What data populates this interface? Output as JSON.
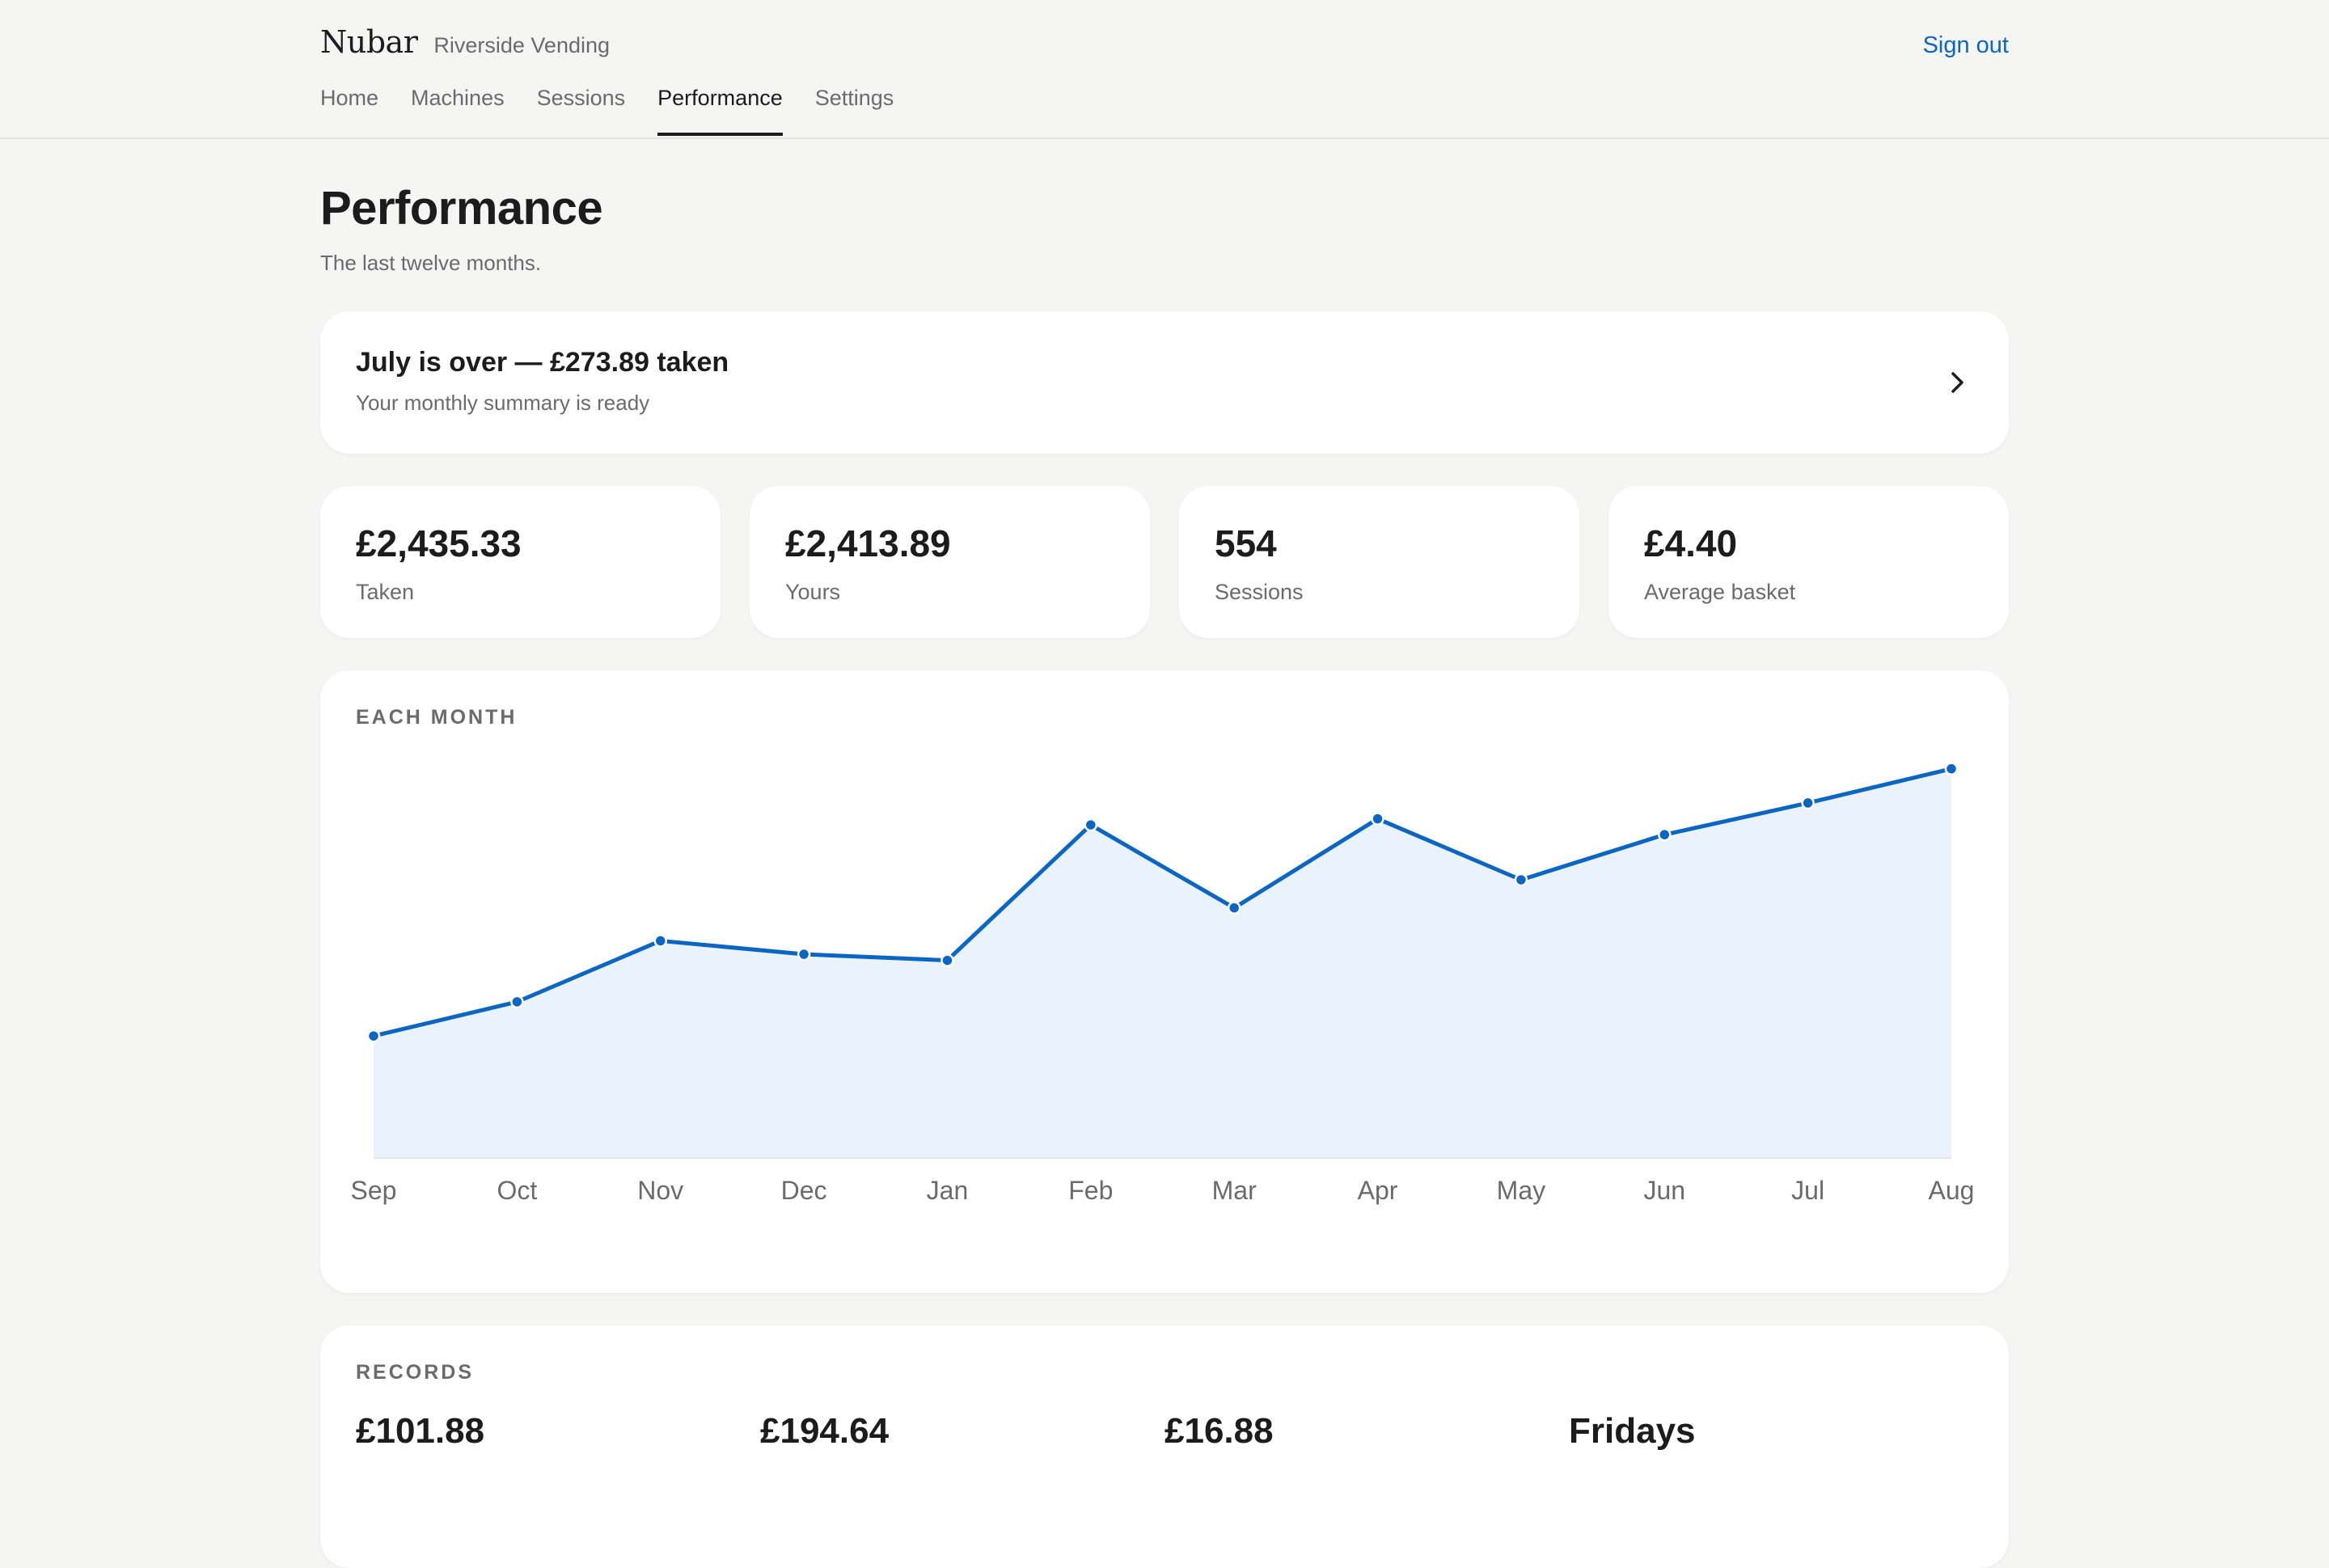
{
  "header": {
    "brand": "Nubar",
    "org": "Riverside Vending",
    "signout": "Sign out",
    "nav": [
      {
        "label": "Home",
        "active": false
      },
      {
        "label": "Machines",
        "active": false
      },
      {
        "label": "Sessions",
        "active": false
      },
      {
        "label": "Performance",
        "active": true
      },
      {
        "label": "Settings",
        "active": false
      }
    ]
  },
  "page": {
    "title": "Performance",
    "subtitle": "The last twelve months."
  },
  "banner": {
    "title": "July is over — £273.89 taken",
    "subtitle": "Your monthly summary is ready",
    "icon": "chevron-right-icon"
  },
  "stats": [
    {
      "value": "£2,435.33",
      "label": "Taken"
    },
    {
      "value": "£2,413.89",
      "label": "Yours"
    },
    {
      "value": "554",
      "label": "Sessions"
    },
    {
      "value": "£4.40",
      "label": "Average basket"
    }
  ],
  "chart_section_label": "EACH MONTH",
  "chart_data": {
    "type": "area",
    "categories": [
      "Sep",
      "Oct",
      "Nov",
      "Dec",
      "Jan",
      "Feb",
      "Mar",
      "Apr",
      "May",
      "Jun",
      "Jul",
      "Aug"
    ],
    "series": [
      {
        "values": [
          100,
          128,
          178,
          167,
          162,
          273,
          205,
          278,
          228,
          265,
          291,
          319
        ]
      }
    ],
    "ylim": [
      0,
      340
    ],
    "grid": false,
    "colors": {
      "line": "#0a66c2",
      "fill": "#eaf2fb"
    }
  },
  "records": {
    "label": "RECORDS",
    "values": [
      "£101.88",
      "£194.64",
      "£16.88",
      "Fridays"
    ]
  }
}
